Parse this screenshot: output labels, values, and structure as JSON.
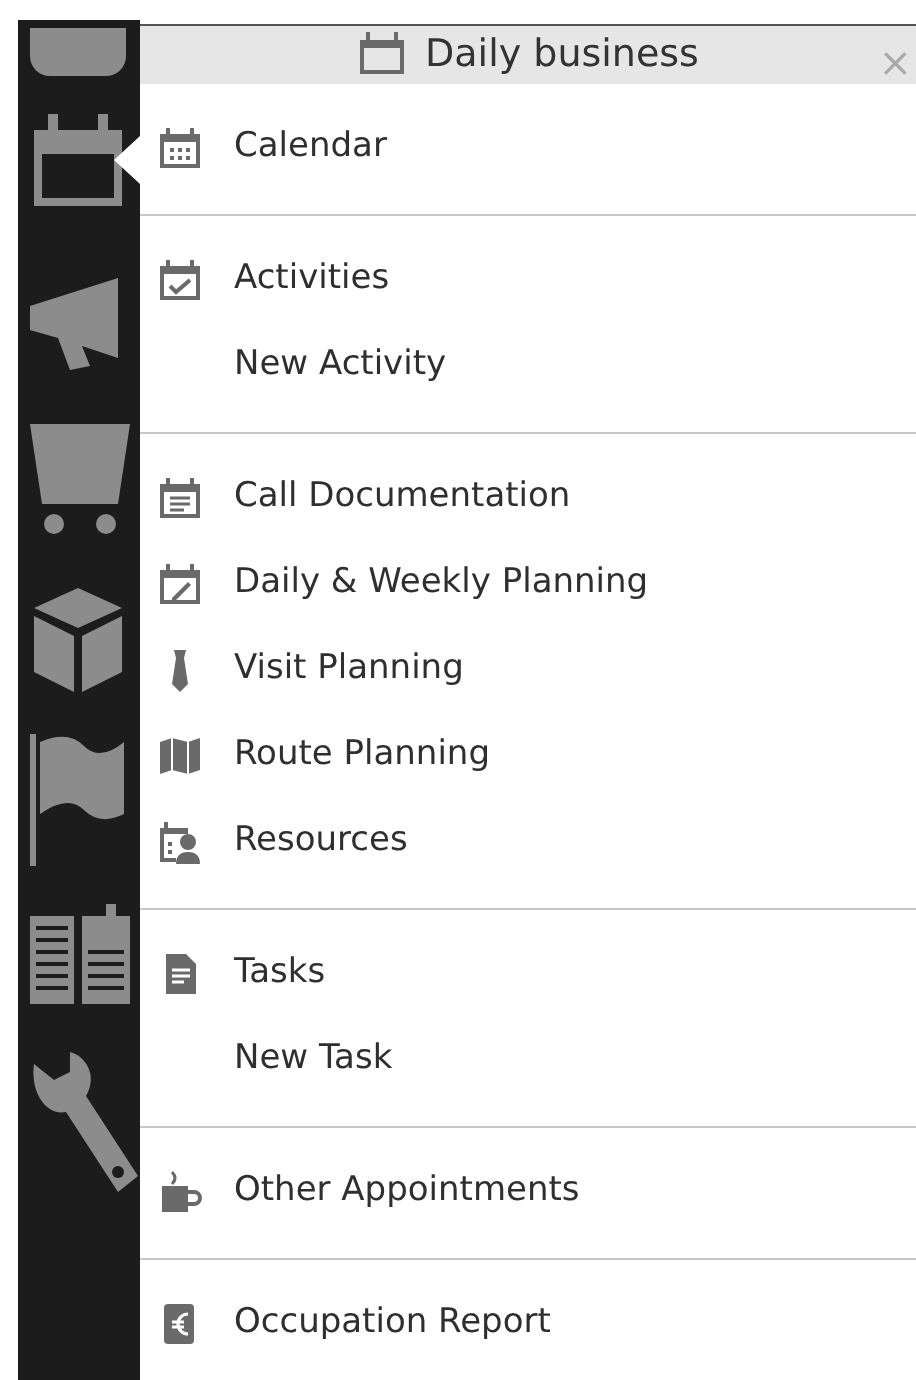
{
  "sidebar": {
    "items": [
      {
        "kind": "blob",
        "selected": false
      },
      {
        "kind": "calendar",
        "selected": true
      },
      {
        "kind": "megaphone",
        "selected": false
      },
      {
        "kind": "cart",
        "selected": false
      },
      {
        "kind": "cube",
        "selected": false
      },
      {
        "kind": "flag",
        "selected": false
      },
      {
        "kind": "book",
        "selected": false
      },
      {
        "kind": "wrench",
        "selected": false
      }
    ]
  },
  "menu": {
    "title": "Daily business",
    "close": "×",
    "groups": [
      {
        "items": [
          {
            "label": "Calendar",
            "kind": "calendar"
          }
        ]
      },
      {
        "items": [
          {
            "label": "Activities",
            "kind": "activity"
          },
          {
            "label": "New Activity",
            "kind": "plain"
          }
        ]
      },
      {
        "items": [
          {
            "label": "Call Documentation",
            "kind": "note"
          },
          {
            "label": "Daily & Weekly Planning",
            "kind": "planning"
          },
          {
            "label": "Visit Planning",
            "kind": "tie"
          },
          {
            "label": "Route Planning",
            "kind": "map"
          },
          {
            "label": "Resources",
            "kind": "resource"
          }
        ]
      },
      {
        "items": [
          {
            "label": "Tasks",
            "kind": "task"
          },
          {
            "label": "New Task",
            "kind": "plain"
          }
        ]
      },
      {
        "items": [
          {
            "label": "Other Appointments",
            "kind": "mug"
          }
        ]
      },
      {
        "items": [
          {
            "label": "Occupation Report",
            "kind": "euro"
          }
        ]
      }
    ]
  }
}
